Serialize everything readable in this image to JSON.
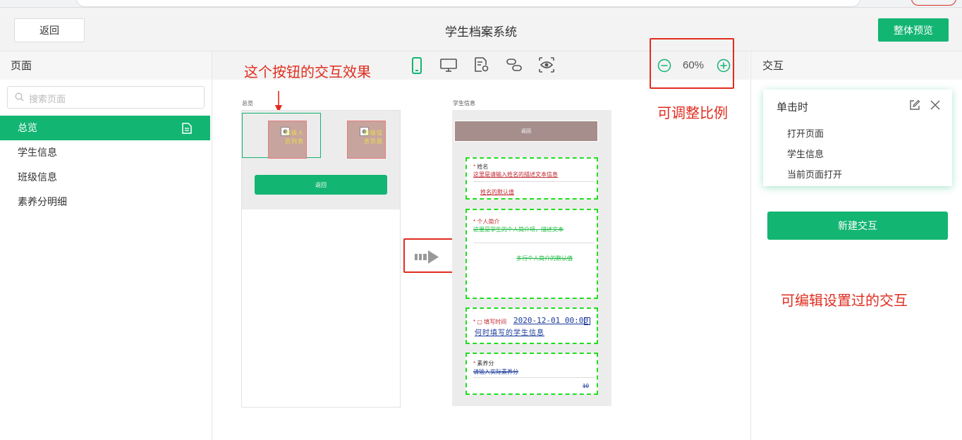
{
  "header": {
    "back_label": "返回",
    "title": "学生档案系统",
    "preview_label": "整体预览"
  },
  "left_panel": {
    "heading": "页面",
    "search_placeholder": "搜索页面",
    "pages": [
      "总览",
      "学生信息",
      "班级信息",
      "素养分明细"
    ]
  },
  "toolbar": {
    "zoom_value": "60%",
    "tools": [
      "mobile-icon",
      "desktop-icon",
      "page-settings-icon",
      "link-icon",
      "eye-icon"
    ]
  },
  "annotations": {
    "button_effect": "这个按钮的交互效果",
    "scale": "可调整比例",
    "editable": "可编辑设置过的交互"
  },
  "canvas": {
    "overview": {
      "label": "总览",
      "tile1_text": "班级人员列表",
      "tile2_text": "班级信息页面",
      "back_button": "返回"
    },
    "student": {
      "label": "学生信息",
      "back_button": "返回",
      "name_label": "姓名",
      "name_desc": "这里是请输入姓名的描述文本信息",
      "name_default": "姓名的默认值",
      "intro_label": "个人简介",
      "intro_desc": "这里是学生的个人简介项，描述文本",
      "intro_default": "多行个人简介的默认值",
      "date_label": "填写时间",
      "date_value": "2020-12-01 00:00",
      "date_desc": "何时填写的学生信息",
      "score_label": "素养分",
      "score_placeholder": "请输入实际素养分",
      "score_value": "10"
    }
  },
  "right_panel": {
    "heading": "交互",
    "card_title": "单击时",
    "card_items": [
      "打开页面",
      "学生信息",
      "当前页面打开"
    ],
    "new_button": "新建交互"
  },
  "colors": {
    "accent": "#13b573",
    "annotation": "#e02d1f",
    "dashed": "#22dd22"
  }
}
